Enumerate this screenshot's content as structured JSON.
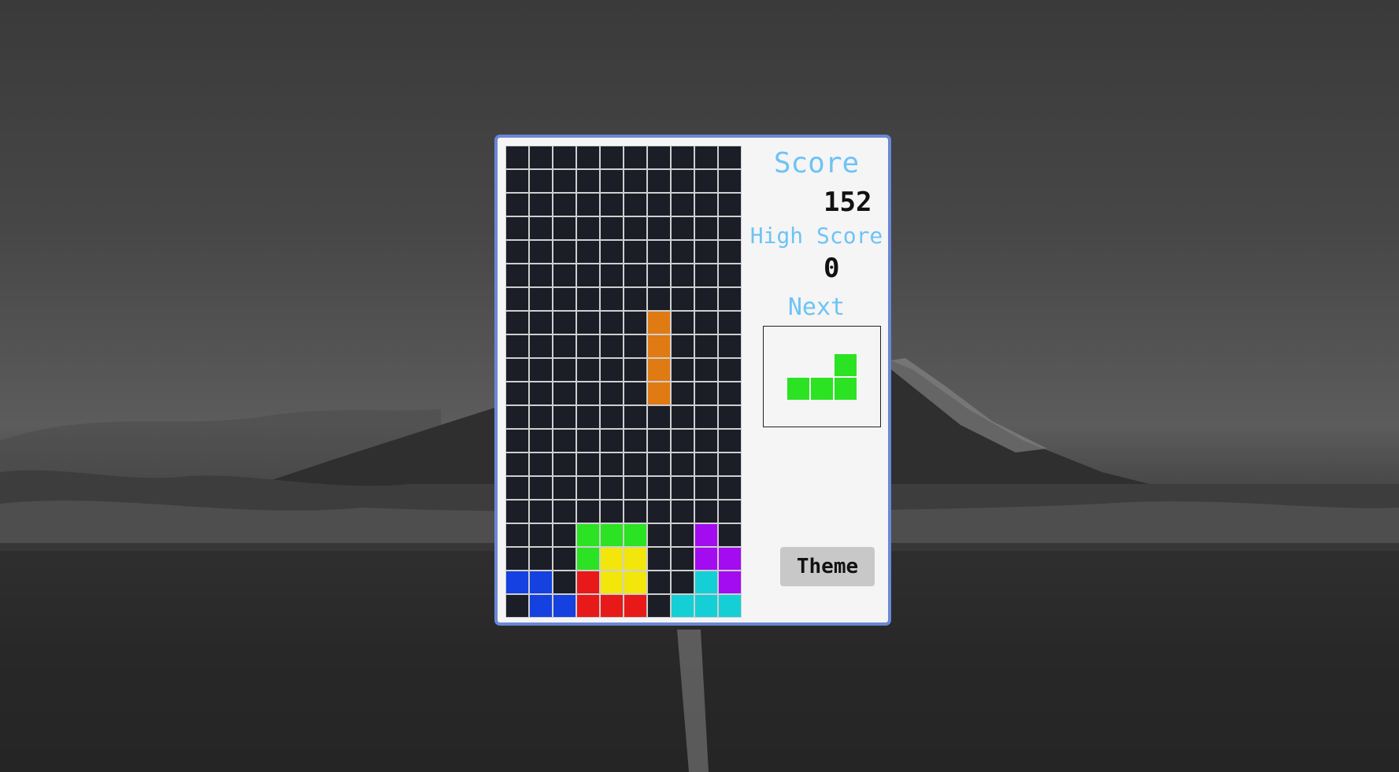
{
  "game": {
    "score_label": "Score",
    "score_value": "152",
    "high_score_label": "High Score",
    "high_score_value": "0",
    "next_label": "Next",
    "theme_label": "Theme"
  },
  "colors": {
    "empty": "#1b1e27",
    "grid": "#cfcfcf",
    "O": "#f2e60a",
    "I": "#e07a12",
    "J": "#1541e0",
    "L": "#2be322",
    "S": "#e81919",
    "T": "#a30cf0",
    "Z": "#15cfd6",
    "frame": "#6b87d6",
    "label": "#6ec3f5"
  },
  "board": {
    "rows": 20,
    "cols": 10,
    "cells": [
      "..........",
      "..........",
      "..........",
      "..........",
      "..........",
      "..........",
      "..........",
      "......I...",
      "......I...",
      "......I...",
      "......I...",
      "..........",
      "..........",
      "..........",
      "..........",
      "..........",
      "...LLL..T.",
      "...LOO..TT",
      "JJ.SOO..ZT",
      ".JJSSS.ZZZ"
    ]
  },
  "next_piece": {
    "type": "L",
    "cells": [
      "..L",
      "LLL"
    ]
  }
}
